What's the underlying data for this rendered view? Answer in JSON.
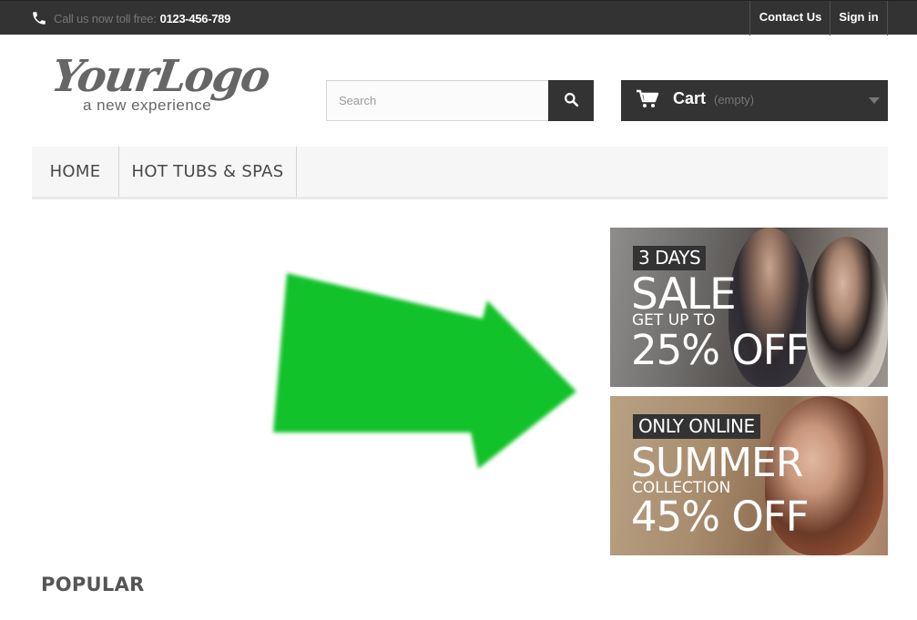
{
  "topbar": {
    "phone_label": "Call us now toll free:",
    "phone_number": "0123-456-789",
    "contact_label": "Contact Us",
    "signin_label": "Sign in"
  },
  "logo": {
    "main": "YourLogo",
    "tagline": "a new experience"
  },
  "search": {
    "placeholder": "Search"
  },
  "cart": {
    "label": "Cart",
    "status": "(empty)"
  },
  "menu": {
    "items": [
      "HOME",
      "HOT TUBS & SPAS"
    ]
  },
  "banners": [
    {
      "tag": "3 DAYS",
      "headline": "SALE",
      "subline": "GET UP TO",
      "discount": "25% OFF"
    },
    {
      "tag": "ONLY ONLINE",
      "headline": "SUMMER",
      "subline": "COLLECTION",
      "discount": "45% OFF"
    }
  ],
  "section": {
    "popular_title": "POPULAR"
  },
  "colors": {
    "dark": "#333333",
    "arrow": "#12c22a",
    "menu_bg": "#f6f6f6"
  },
  "icons": {
    "phone": "phone-icon",
    "search": "search-icon",
    "cart": "cart-icon",
    "caret": "caret-down-icon",
    "arrow": "arrow-right-icon"
  }
}
